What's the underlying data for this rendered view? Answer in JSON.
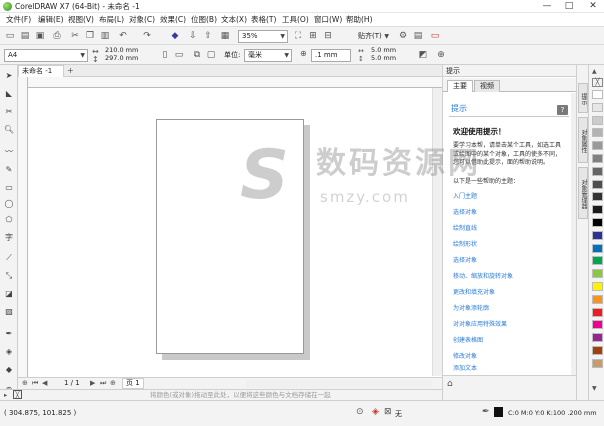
{
  "window": {
    "title": "CorelDRAW X7 (64-Bit) - 未命名 -1",
    "minimize": "—",
    "maximize": "□",
    "close": "✕"
  },
  "menu": [
    "文件(F)",
    "编辑(E)",
    "视图(V)",
    "布局(L)",
    "对象(C)",
    "效果(C)",
    "位图(B)",
    "文本(X)",
    "表格(T)",
    "工具(O)",
    "窗口(W)",
    "帮助(H)"
  ],
  "toolbar": {
    "zoom": "35%",
    "snap": "贴齐(T)"
  },
  "propbar": {
    "page_size": "A4",
    "width": "210.0 mm",
    "height": "297.0 mm",
    "units_label": "单位:",
    "units": "毫米",
    "nudge": ".1 mm",
    "dup_x": "5.0 mm",
    "dup_y": "5.0 mm"
  },
  "doc_tab": {
    "name": "未命名 -1",
    "add": "+"
  },
  "page_nav": {
    "counter": "1 / 1",
    "page_tab": "页 1"
  },
  "palette_bar": {
    "hint": "将颜色(或对象)拖动至此处，以便将这些颜色与文档存储在一起"
  },
  "status": {
    "coords": "( 304.875, 101.825 )",
    "none": "无",
    "color_info": "C:0 M:0 Y:0 K:100 .200 mm"
  },
  "docker": {
    "title": "提示",
    "tabs": [
      "主要",
      "视频"
    ],
    "hint_label": "提示",
    "help_icon": "?",
    "welcome": "欢迎使用提示！",
    "intro": "要学习本帮，请单击某个工具，如选工具或绘图中的某个对象，工具的使多不同，您可以借助此提示，面的帮助说明。",
    "topics_label": "以下是一些帮助的主题：",
    "topics": [
      "入门主题",
      "选择对象",
      "绘制直线",
      "绘制形状",
      "选择对象",
      "移动、缩放和旋转对象",
      "更改和填充对象",
      "为对象添轮廓",
      "对对象应用特殊效果",
      "创建表格图",
      "修改对象",
      "添加文本",
      "更换背景"
    ],
    "side_tabs": [
      "提示",
      "对象属性",
      "对象管理器"
    ]
  },
  "palette_colors": [
    "#ffffff",
    "#e6e6e6",
    "#cccccc",
    "#b3b3b3",
    "#999999",
    "#808080",
    "#666666",
    "#4d4d4d",
    "#333333",
    "#1a1a1a",
    "#000000",
    "#2d3192",
    "#0072bc",
    "#00a651",
    "#8dc63f",
    "#fff200",
    "#f7941d",
    "#ed1c24",
    "#ec008c",
    "#92278f",
    "#a0410d",
    "#c69c6d"
  ],
  "watermark": {
    "big_letter": "S",
    "text": "数码资源网",
    "sub": "smzy.com"
  }
}
